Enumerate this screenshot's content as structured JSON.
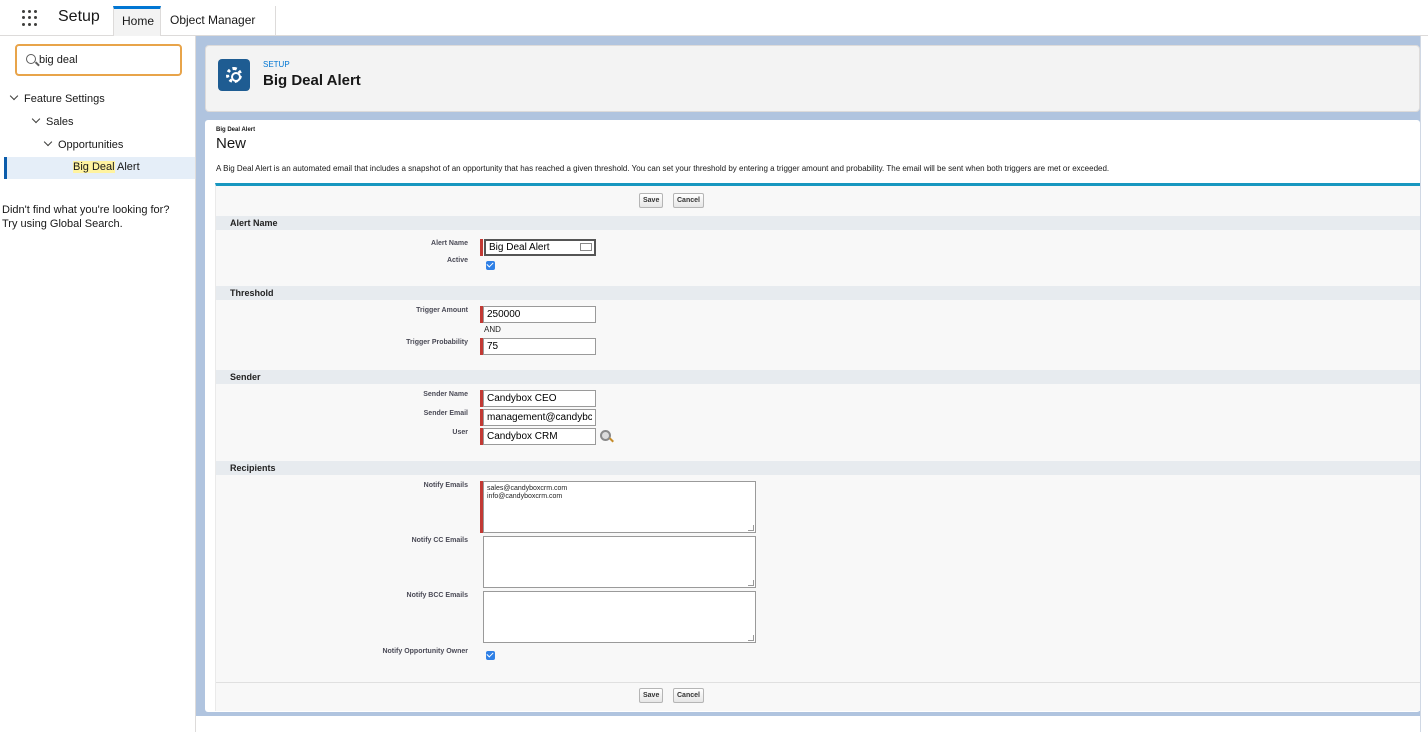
{
  "app": {
    "name": "Setup"
  },
  "tabs": [
    {
      "label": "Home"
    },
    {
      "label": "Object Manager"
    }
  ],
  "sidebar": {
    "search_value": "big deal",
    "tree": {
      "feature_settings": "Feature Settings",
      "sales": "Sales",
      "opportunities": "Opportunities",
      "selected_highlight": "Big Deal",
      "selected_rest": " Alert"
    },
    "help_line1": "Didn't find what you're looking for?",
    "help_line2": "Try using Global Search."
  },
  "header": {
    "subtitle": "SETUP",
    "title": "Big Deal Alert",
    "icon": "gear-icon"
  },
  "page": {
    "breadcrumb": "Big Deal Alert",
    "title": "New",
    "description": "A Big Deal Alert is an automated email that includes a snapshot of an opportunity that has reached a given threshold. You can set your threshold by entering a trigger amount and probability. The email will be sent when both triggers are met or exceeded."
  },
  "buttons": {
    "save": "Save",
    "cancel": "Cancel"
  },
  "sections": {
    "alert_name": "Alert Name",
    "threshold": "Threshold",
    "sender": "Sender",
    "recipients": "Recipients"
  },
  "fields": {
    "alert_name": {
      "label": "Alert Name",
      "value": "Big Deal Alert"
    },
    "active": {
      "label": "Active",
      "checked": true
    },
    "trigger_amount": {
      "label": "Trigger Amount",
      "value": "250000"
    },
    "and_text": "AND",
    "trigger_probability": {
      "label": "Trigger Probability",
      "value": "75"
    },
    "sender_name": {
      "label": "Sender Name",
      "value": "Candybox CEO"
    },
    "sender_email": {
      "label": "Sender Email",
      "value": "management@candybc"
    },
    "user": {
      "label": "User",
      "value": "Candybox CRM"
    },
    "notify_emails": {
      "label": "Notify Emails",
      "value": "sales@candyboxcrm.com\ninfo@candyboxcrm.com"
    },
    "notify_cc": {
      "label": "Notify CC Emails",
      "value": ""
    },
    "notify_bcc": {
      "label": "Notify BCC Emails",
      "value": ""
    },
    "notify_owner": {
      "label": "Notify Opportunity Owner",
      "checked": true
    }
  },
  "colors": {
    "accent": "#0176d3",
    "required": "#c23934",
    "search_focus": "#e8a44a",
    "page_background": "#b0c4df"
  }
}
